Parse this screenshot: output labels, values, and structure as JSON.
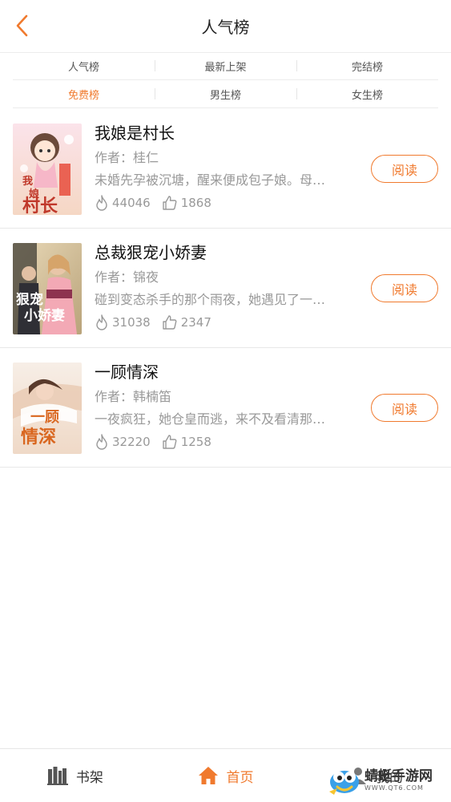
{
  "header": {
    "title": "人气榜"
  },
  "filters": {
    "row1": [
      "人气榜",
      "最新上架",
      "完结榜"
    ],
    "row2": [
      "免费榜",
      "男生榜",
      "女生榜"
    ],
    "active": "免费榜"
  },
  "books": [
    {
      "title": "我娘是村长",
      "author": "作者：桂仁",
      "desc": "未婚先孕被沉塘，醒来便成包子娘。母…",
      "hot": "44046",
      "likes": "1868",
      "read": "阅读",
      "cover_text": "我娘是村长"
    },
    {
      "title": "总裁狠宠小娇妻",
      "author": "作者：锦夜",
      "desc": "碰到变态杀手的那个雨夜，她遇见了一…",
      "hot": "31038",
      "likes": "2347",
      "read": "阅读",
      "cover_text": "总裁狠宠小娇妻"
    },
    {
      "title": "一顾情深",
      "author": "作者：韩楠笛",
      "desc": "一夜疯狂，她仓皇而逃，来不及看清那…",
      "hot": "32220",
      "likes": "1258",
      "read": "阅读",
      "cover_text": "一顾情深"
    }
  ],
  "tabbar": {
    "shelf": "书架",
    "home": "首页",
    "mine": "我的"
  },
  "watermark": {
    "main": "蜻蜓手游网",
    "sub": "WWW.QT6.COM"
  },
  "colors": {
    "accent": "#f07a2e",
    "text_gray": "#999999"
  }
}
